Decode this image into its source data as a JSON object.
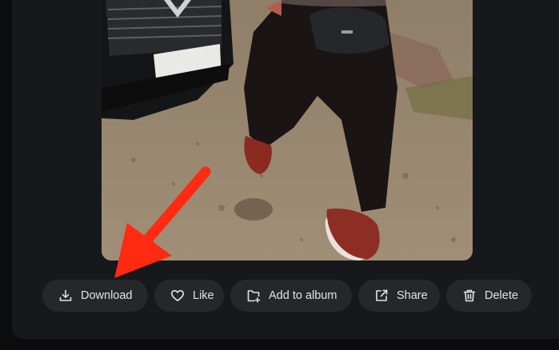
{
  "actions": {
    "download": "Download",
    "like": "Like",
    "add_to_album": "Add to album",
    "share": "Share",
    "delete": "Delete"
  },
  "colors": {
    "background": "#0b0c0e",
    "panel": "#17181b",
    "button_bg": "#26272b",
    "button_text": "#e4e4e6",
    "annotation_arrow": "#ff2a12"
  },
  "icons": [
    "download-icon",
    "heart-icon",
    "add-to-album-icon",
    "share-icon",
    "trash-icon"
  ]
}
